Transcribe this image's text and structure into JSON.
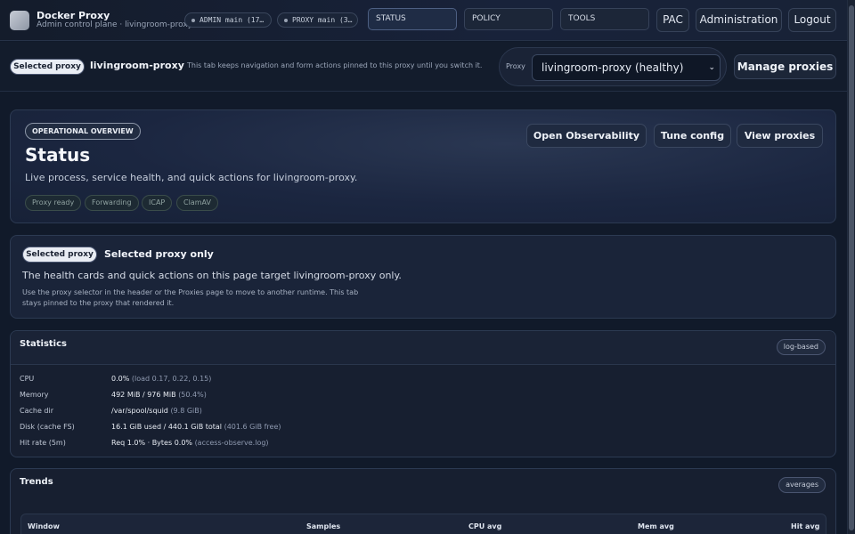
{
  "header": {
    "brand_title": "Docker Proxy",
    "brand_subtitle": "Admin control plane · livingroom-proxy",
    "admin_pill": "ADMIN main (17…",
    "proxy_pill": "PROXY main (3…",
    "tabs": [
      {
        "label": "STATUS",
        "active": true
      },
      {
        "label": "POLICY",
        "active": false
      },
      {
        "label": "TOOLS",
        "active": false
      }
    ],
    "pac_label": "PAC",
    "admin_label": "Administration",
    "logout_label": "Logout"
  },
  "proxy_strip": {
    "tag": "Selected proxy",
    "proxy_name": "livingroom-proxy",
    "note": "This tab keeps navigation and form actions pinned to this proxy until you switch it.",
    "selector_label": "Proxy",
    "selector_value": "livingroom-proxy (healthy)",
    "manage_label": "Manage proxies"
  },
  "hero": {
    "eyebrow": "OPERATIONAL OVERVIEW",
    "title": "Status",
    "description": "Live process, service health, and quick actions for livingroom-proxy.",
    "chips": [
      "Proxy ready",
      "Forwarding",
      "ICAP",
      "ClamAV"
    ],
    "actions": [
      "Open Observability",
      "Tune config",
      "View proxies"
    ]
  },
  "scope": {
    "tag": "Selected proxy",
    "title": "Selected proxy only",
    "lead": "The health cards and quick actions on this page target livingroom-proxy only.",
    "small": "Use the proxy selector in the header or the Proxies page to move to another runtime. This tab stays pinned to the proxy that rendered it."
  },
  "statistics": {
    "title": "Statistics",
    "badge": "log-based",
    "rows": [
      {
        "label": "CPU",
        "value": "0.0%",
        "detail": "(load 0.17, 0.22, 0.15)"
      },
      {
        "label": "Memory",
        "value": "492 MiB / 976 MiB",
        "detail": "(50.4%)"
      },
      {
        "label": "Cache dir",
        "value": "/var/spool/squid",
        "detail": "(9.8 GiB)"
      },
      {
        "label": "Disk (cache FS)",
        "value": "16.1 GiB used / 440.1 GiB total",
        "detail": "(401.6 GiB free)"
      },
      {
        "label": "Hit rate (5m)",
        "value": "Req 1.0% · Bytes 0.0%",
        "detail": "(access-observe.log)"
      }
    ]
  },
  "trends": {
    "title": "Trends",
    "badge": "averages",
    "columns": [
      "Window",
      "Samples",
      "CPU avg",
      "Mem avg",
      "Hit avg"
    ]
  }
}
